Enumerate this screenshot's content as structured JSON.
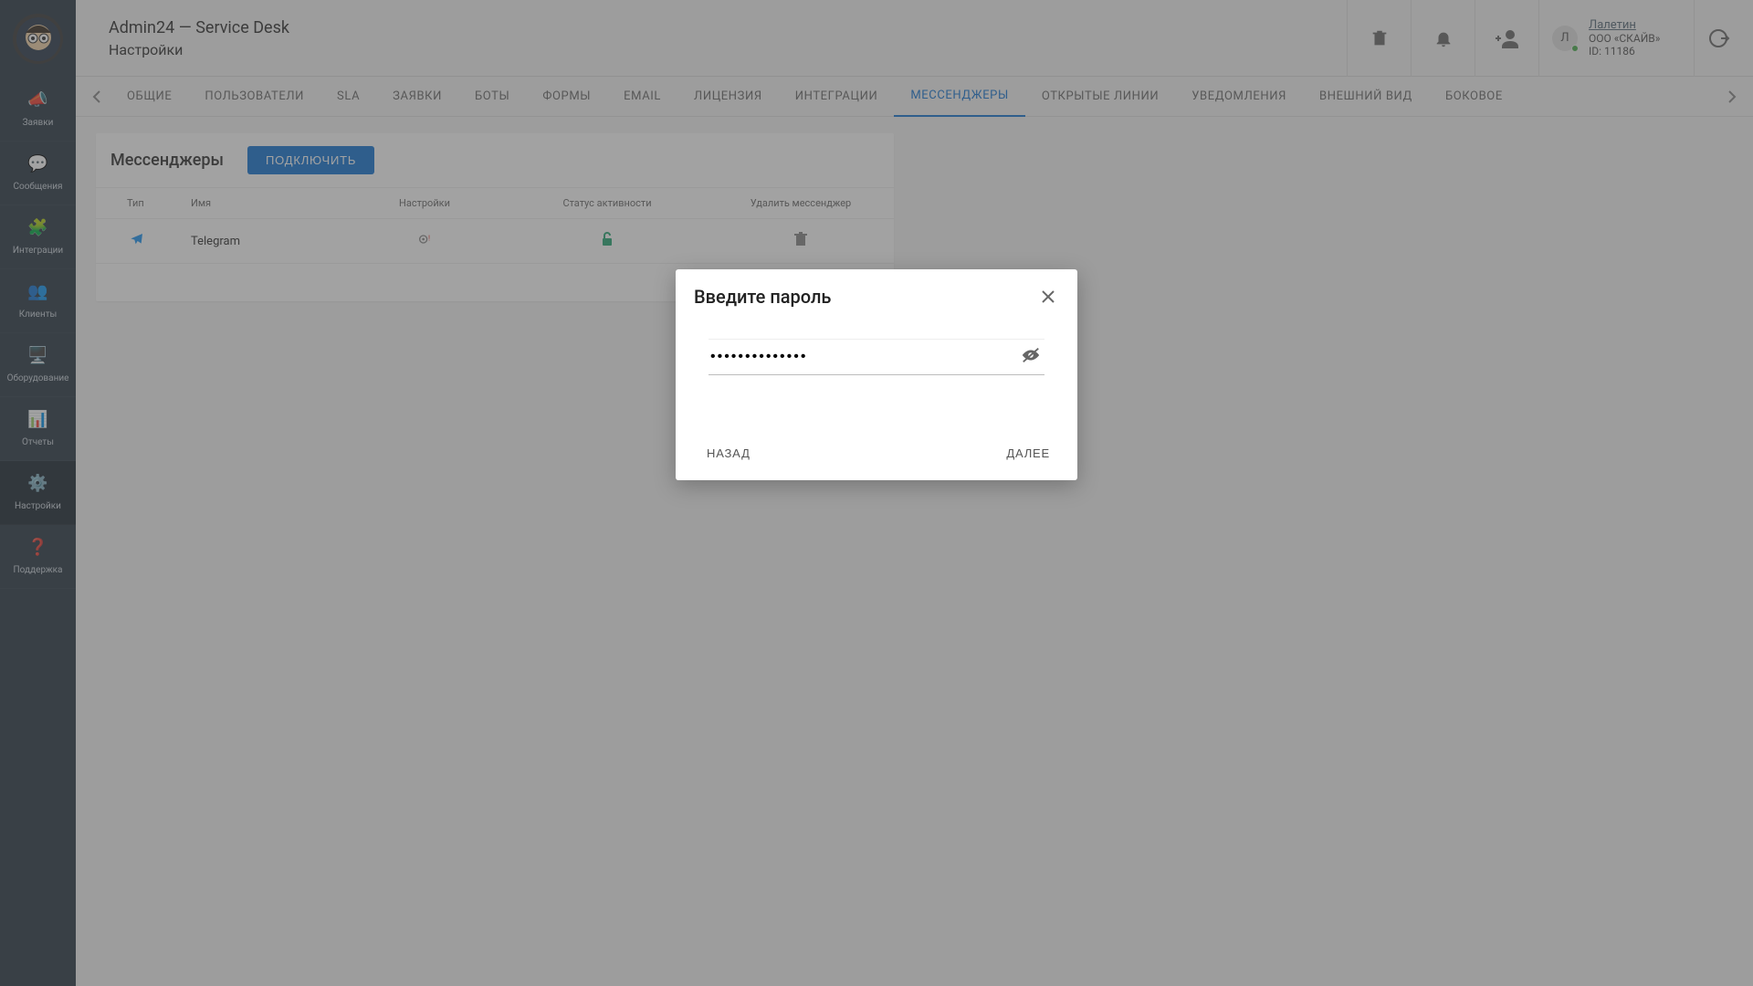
{
  "header": {
    "title1": "Admin24 — Service Desk",
    "title2": "Настройки"
  },
  "user": {
    "initial": "Л",
    "name": "Лалетин",
    "company": "ООО «СКАЙВ»",
    "id_label": "ID: 11186"
  },
  "sidebar": {
    "items": [
      {
        "label": "Заявки"
      },
      {
        "label": "Сообщения"
      },
      {
        "label": "Интеграции"
      },
      {
        "label": "Клиенты"
      },
      {
        "label": "Оборудование"
      },
      {
        "label": "Отчеты"
      },
      {
        "label": "Настройки"
      },
      {
        "label": "Поддержка"
      }
    ]
  },
  "tabs": {
    "items": [
      "ОБЩИЕ",
      "ПОЛЬЗОВАТЕЛИ",
      "SLA",
      "ЗАЯВКИ",
      "БОТЫ",
      "ФОРМЫ",
      "EMAIL",
      "ЛИЦЕНЗИЯ",
      "ИНТЕГРАЦИИ",
      "МЕССЕНДЖЕРЫ",
      "ОТКРЫТЫЕ ЛИНИИ",
      "УВЕДОМЛЕНИЯ",
      "ВНЕШНИЙ ВИД",
      "БОКОВОЕ"
    ],
    "active_index": 9
  },
  "messengers": {
    "section_title": "Мессенджеры",
    "connect_label": "ПОДКЛЮЧИТЬ",
    "columns": {
      "type": "Тип",
      "name": "Имя",
      "settings": "Настройки",
      "status": "Статус активности",
      "delete": "Удалить мессенджер"
    },
    "rows": [
      {
        "name": "Telegram"
      }
    ]
  },
  "dialog": {
    "title": "Введите пароль",
    "password_value": "••••••••••••••",
    "back_label": "НАЗАД",
    "next_label": "ДАЛЕЕ"
  }
}
